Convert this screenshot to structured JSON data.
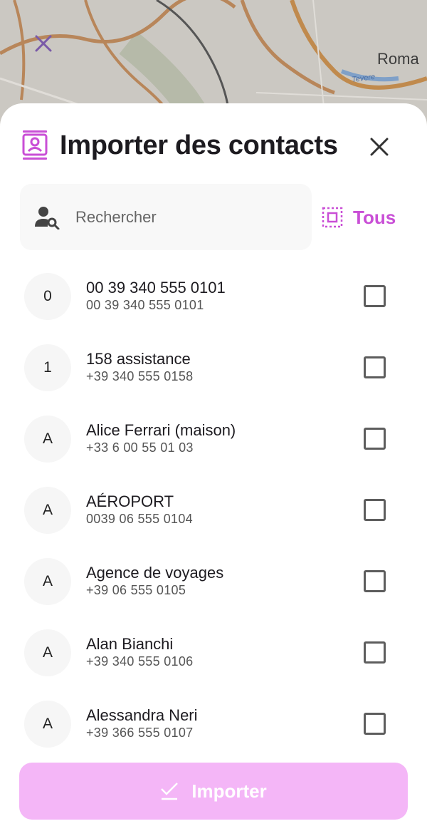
{
  "map": {
    "place_label": "Roma",
    "river_label": "Tevere",
    "close_icon": "close-icon"
  },
  "header": {
    "title": "Importer des contacts",
    "icon": "contacts-icon",
    "close_icon": "close-icon"
  },
  "search": {
    "placeholder": "Rechercher",
    "value": "",
    "icon": "person-search-icon"
  },
  "select_all": {
    "label": "Tous",
    "icon": "select-all-icon"
  },
  "contacts": [
    {
      "initial": "0",
      "name": "00 39 340 555 0101",
      "phone": "00 39 340 555 0101",
      "checked": false
    },
    {
      "initial": "1",
      "name": "158 assistance",
      "phone": "+39 340 555 0158",
      "checked": false
    },
    {
      "initial": "A",
      "name": "Alice Ferrari (maison)",
      "phone": "+33 6 00 55 01 03",
      "checked": false
    },
    {
      "initial": "A",
      "name": "AÉROPORT",
      "phone": "0039 06 555 0104",
      "checked": false
    },
    {
      "initial": "A",
      "name": "Agence de voyages",
      "phone": "+39 06 555 0105",
      "checked": false
    },
    {
      "initial": "A",
      "name": "Alan Bianchi",
      "phone": "+39 340 555 0106",
      "checked": false
    },
    {
      "initial": "A",
      "name": "Alessandra Neri",
      "phone": "+39 366 555 0107",
      "checked": false
    }
  ],
  "import_button": {
    "label": "Importer",
    "icon": "check-icon",
    "enabled": false
  },
  "colors": {
    "accent": "#c94fd6",
    "button_disabled": "#f4b6f7",
    "map_overlay": "#c9c6c0"
  }
}
